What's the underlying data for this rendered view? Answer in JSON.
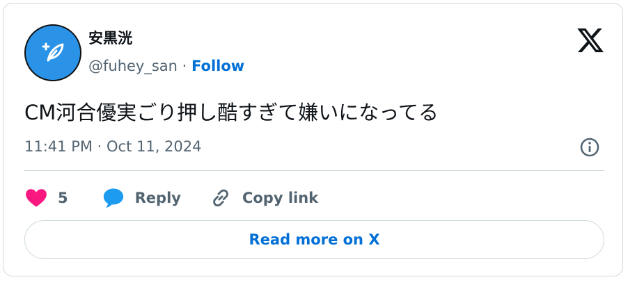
{
  "author": {
    "name": "安黒洸",
    "handle": "@fuhey_san",
    "separator": "·",
    "follow_label": "Follow"
  },
  "tweet": {
    "text": "CM河合優実ごり押し酷すぎて嫌いになってる",
    "timestamp": "11:41 PM · Oct 11, 2024"
  },
  "actions": {
    "like_count": "5",
    "reply_label": "Reply",
    "copy_label": "Copy link"
  },
  "read_more_label": "Read more on X",
  "icons": {
    "avatar": "feather-quill-icon",
    "brand": "x-logo-icon",
    "info": "info-icon",
    "like": "heart-icon",
    "reply": "speech-bubble-icon",
    "copy": "link-icon"
  },
  "colors": {
    "accent": "#006fd6",
    "like": "#f91880",
    "reply": "#1d9bf0",
    "avatar_bg": "#2a93e8",
    "muted": "#536471",
    "text": "#0f1419",
    "border": "#cfd9de"
  }
}
